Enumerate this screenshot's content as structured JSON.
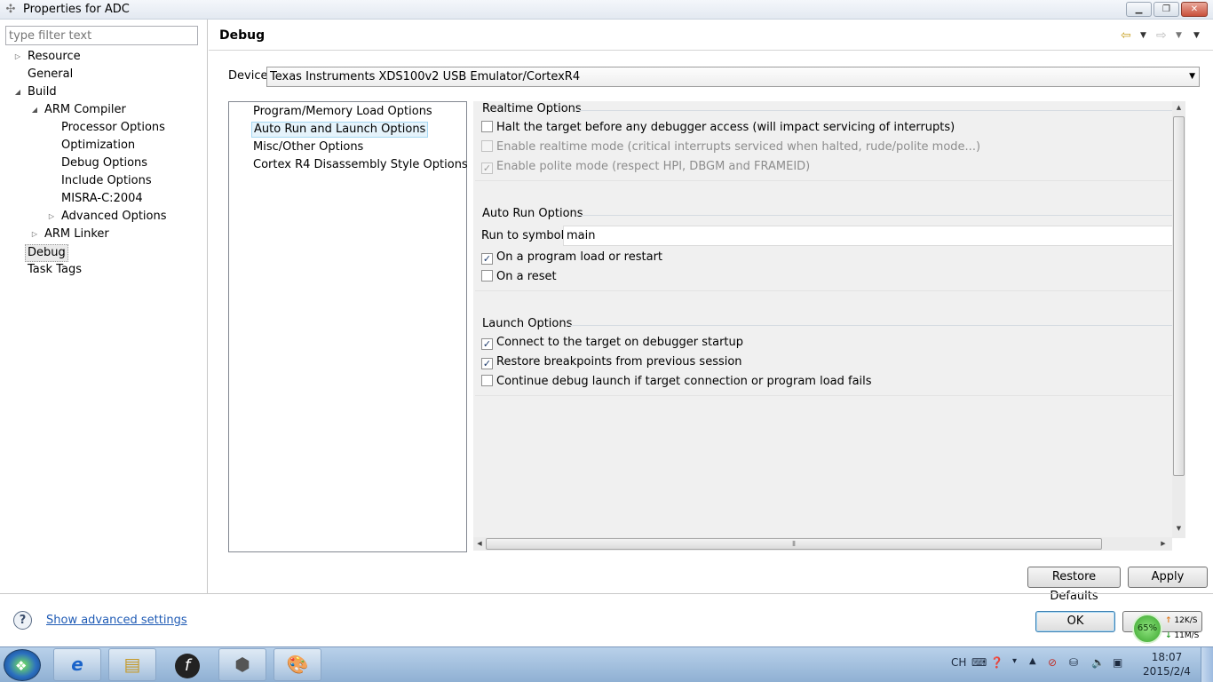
{
  "window": {
    "title": "Properties for ADC"
  },
  "filter": {
    "placeholder": "type filter text"
  },
  "tree": {
    "resource": "Resource",
    "general": "General",
    "build": "Build",
    "arm_compiler": "ARM Compiler",
    "processor_options": "Processor Options",
    "optimization": "Optimization",
    "debug_options": "Debug Options",
    "include_options": "Include Options",
    "misra": "MISRA-C:2004",
    "advanced_options": "Advanced Options",
    "arm_linker": "ARM Linker",
    "debug": "Debug",
    "task_tags": "Task Tags"
  },
  "page": {
    "title": "Debug"
  },
  "device": {
    "label": "Device",
    "value": "Texas Instruments XDS100v2 USB Emulator/CortexR4"
  },
  "option_list": [
    "Program/Memory Load Options",
    "Auto Run and Launch Options",
    "Misc/Other Options",
    "Cortex R4 Disassembly Style Options"
  ],
  "realtime": {
    "title": "Realtime Options",
    "halt": "Halt the target before any debugger access (will impact servicing of interrupts)",
    "enable_realtime": "Enable realtime mode (critical interrupts serviced when halted, rude/polite mode...)",
    "polite": "Enable polite mode (respect HPI, DBGM and FRAMEID)"
  },
  "autorun": {
    "title": "Auto Run Options",
    "run_to_symbol_label": "Run to symbol",
    "run_to_symbol_value": "main",
    "on_load": "On a program load or restart",
    "on_reset": "On a reset"
  },
  "launch": {
    "title": "Launch Options",
    "connect": "Connect to the target on debugger startup",
    "restore_bp": "Restore breakpoints from previous session",
    "continue_launch": "Continue debug launch if target connection or program load fails"
  },
  "buttons": {
    "restore_defaults": "Restore Defaults",
    "apply": "Apply",
    "ok": "OK"
  },
  "footer": {
    "advanced_link": "Show advanced settings"
  },
  "network": {
    "percent": "65%",
    "up": "12K/S",
    "down": "11M/S"
  },
  "taskbar": {
    "ime": "CH",
    "time": "18:07",
    "date": "2015/2/4"
  },
  "icons": {
    "back": "arrow-left",
    "forward": "arrow-right",
    "menu": "chevron-down",
    "help": "question",
    "start": "windows",
    "ie": "e",
    "explorer": "folder",
    "flash": "f",
    "app": "cube",
    "paint": "palette"
  }
}
